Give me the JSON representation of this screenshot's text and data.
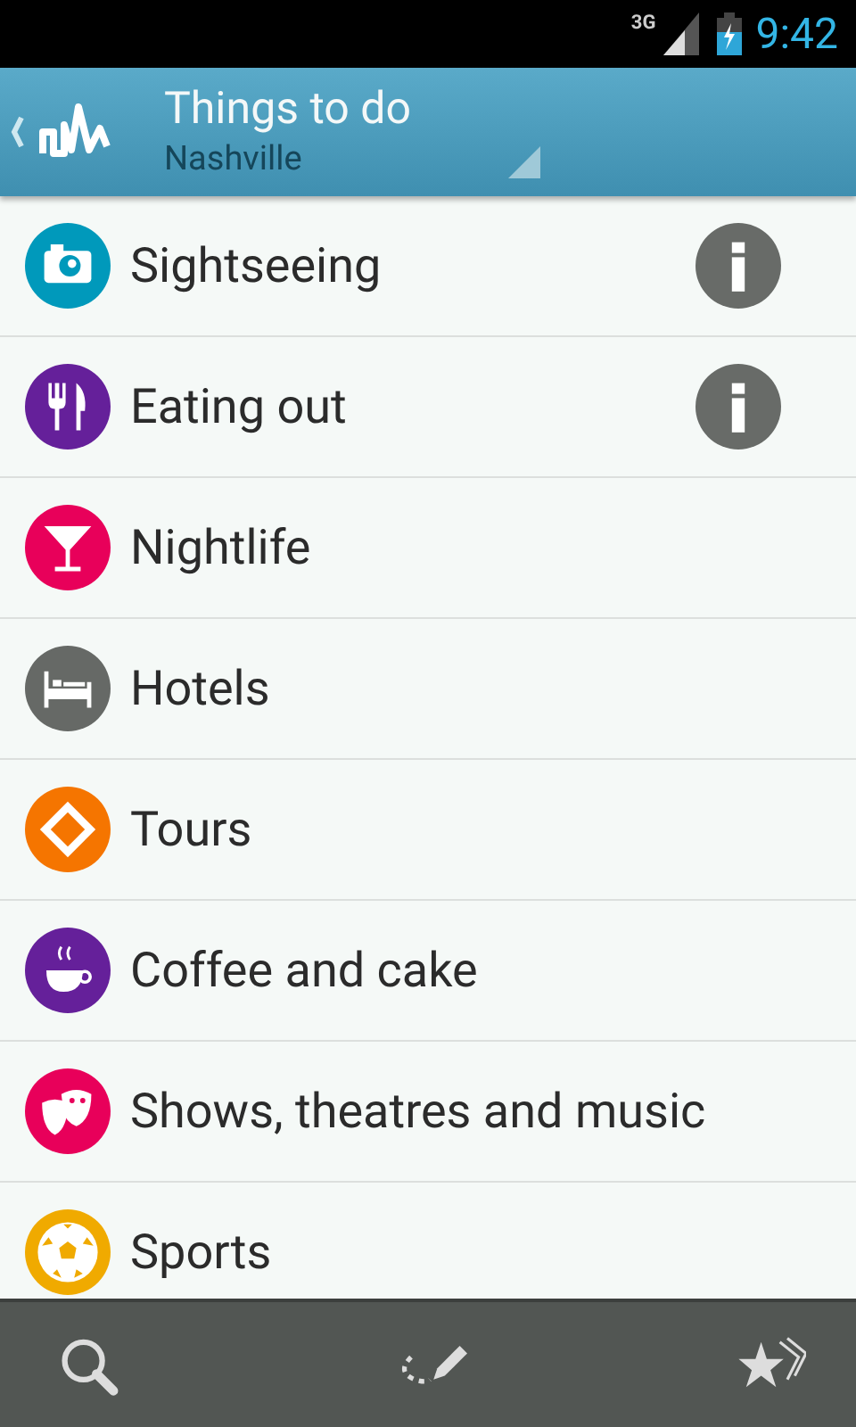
{
  "status_bar": {
    "network": "3G",
    "time": "9:42"
  },
  "header": {
    "title": "Things to do",
    "subtitle": "Nashville"
  },
  "categories": [
    {
      "label": "Sightseeing",
      "kind": "camera",
      "color": "#0099bb",
      "info": true
    },
    {
      "label": "Eating out",
      "kind": "cutlery",
      "color": "#65209a",
      "info": true
    },
    {
      "label": "Nightlife",
      "kind": "cocktail",
      "color": "#e8005a",
      "info": false
    },
    {
      "label": "Hotels",
      "kind": "bed",
      "color": "#666966",
      "info": false
    },
    {
      "label": "Tours",
      "kind": "ticket",
      "color": "#f57500",
      "info": false
    },
    {
      "label": "Coffee and cake",
      "kind": "cup",
      "color": "#65209a",
      "info": false
    },
    {
      "label": "Shows, theatres and music",
      "kind": "masks",
      "color": "#e8005a",
      "info": false
    },
    {
      "label": "Sports",
      "kind": "ball",
      "color": "#f0aa00",
      "info": false
    }
  ],
  "toolbar": [
    {
      "kind": "search"
    },
    {
      "kind": "draw"
    },
    {
      "kind": "favorites"
    }
  ]
}
